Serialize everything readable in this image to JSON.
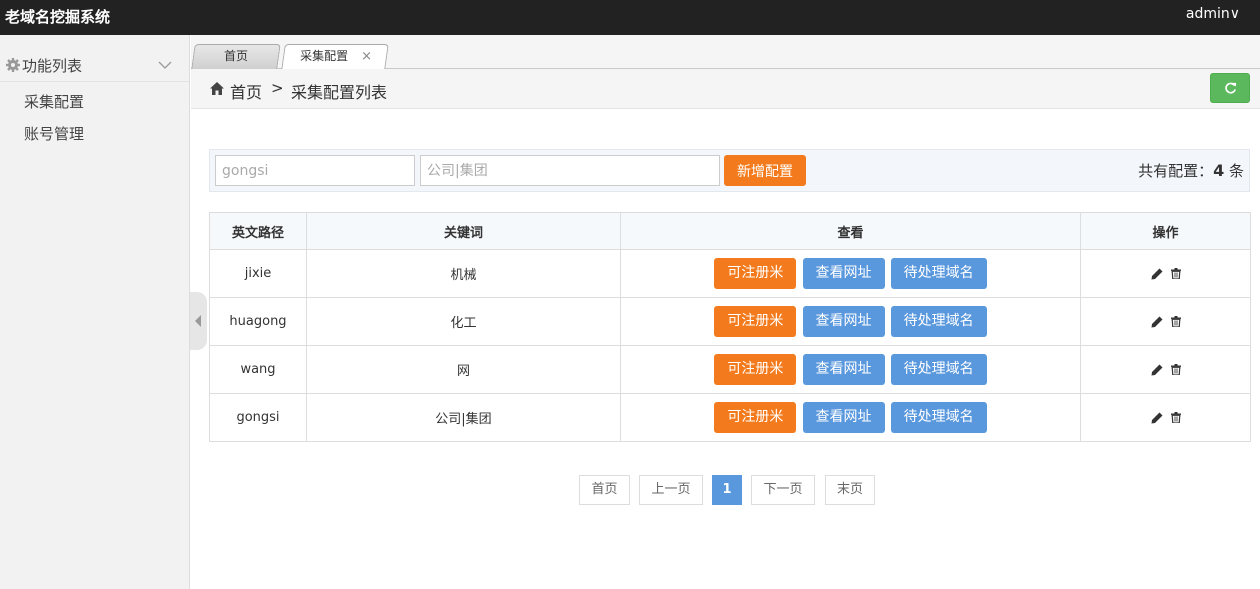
{
  "header": {
    "brand": "老域名挖掘系统",
    "user": "admin∨"
  },
  "sidebar": {
    "section_title": "功能列表",
    "items": [
      {
        "label": "采集配置"
      },
      {
        "label": "账号管理"
      }
    ]
  },
  "tabs": [
    {
      "label": "首页"
    },
    {
      "label": "采集配置",
      "close": "×"
    }
  ],
  "breadcrumb": {
    "home": "首页",
    "separator": ">",
    "current": "采集配置列表"
  },
  "search": {
    "path_placeholder": "gongsi",
    "keyword_placeholder": "公司|集团",
    "add_label": "新增配置",
    "total_prefix": "共有配置：",
    "total_count": "4",
    "total_suffix": " 条"
  },
  "table": {
    "headers": {
      "path": "英文路径",
      "keyword": "关键词",
      "view": "查看",
      "ops": "操作"
    },
    "buttons": {
      "registerable": "可注册米",
      "view_urls": "查看网址",
      "pending": "待处理域名"
    },
    "rows": [
      {
        "path": "jixie",
        "keyword": "机械"
      },
      {
        "path": "huagong",
        "keyword": "化工"
      },
      {
        "path": "wang",
        "keyword": "网"
      },
      {
        "path": "gongsi",
        "keyword": "公司|集团"
      }
    ]
  },
  "pagination": {
    "first": "首页",
    "prev": "上一页",
    "current": "1",
    "next": "下一页",
    "last": "末页"
  },
  "colors": {
    "orange": "#f37b1d",
    "blue": "#5a98de",
    "green": "#5cb85c",
    "topbar": "#222222"
  }
}
